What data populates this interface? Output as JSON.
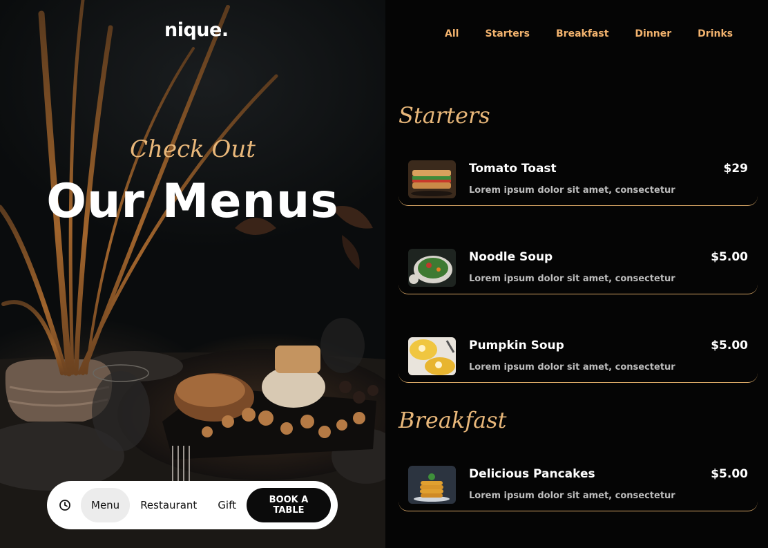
{
  "hero": {
    "logo": "nique.",
    "kicker": "Check Out",
    "headline": "Our Menus"
  },
  "bottom_nav": {
    "icon": "clock-icon",
    "items": [
      "Menu",
      "Restaurant",
      "Gift"
    ],
    "active": "Menu",
    "book_label": "BOOK A TABLE"
  },
  "tabs": [
    "All",
    "Starters",
    "Breakfast",
    "Dinner",
    "Drinks"
  ],
  "sections": [
    {
      "title": "Starters",
      "items": [
        {
          "name": "Tomato Toast",
          "desc": "Lorem ipsum dolor sit amet, consectetur",
          "price": "$29",
          "image": "sandwich"
        },
        {
          "name": "Noodle Soup",
          "desc": "Lorem ipsum dolor sit amet, consectetur",
          "price": "$5.00",
          "image": "salad-bowl"
        },
        {
          "name": "Pumpkin Soup",
          "desc": "Lorem ipsum dolor sit amet, consectetur",
          "price": "$5.00",
          "image": "soup-bowls"
        }
      ]
    },
    {
      "title": "Breakfast",
      "items": [
        {
          "name": "Delicious Pancakes",
          "desc": "Lorem ipsum dolor sit amet, consectetur",
          "price": "$5.00",
          "image": "pancake-stack"
        }
      ]
    }
  ],
  "colors": {
    "accent": "#e8b77a",
    "tab": "#f2b36e",
    "background": "#050505",
    "divider": "#d9a766"
  }
}
